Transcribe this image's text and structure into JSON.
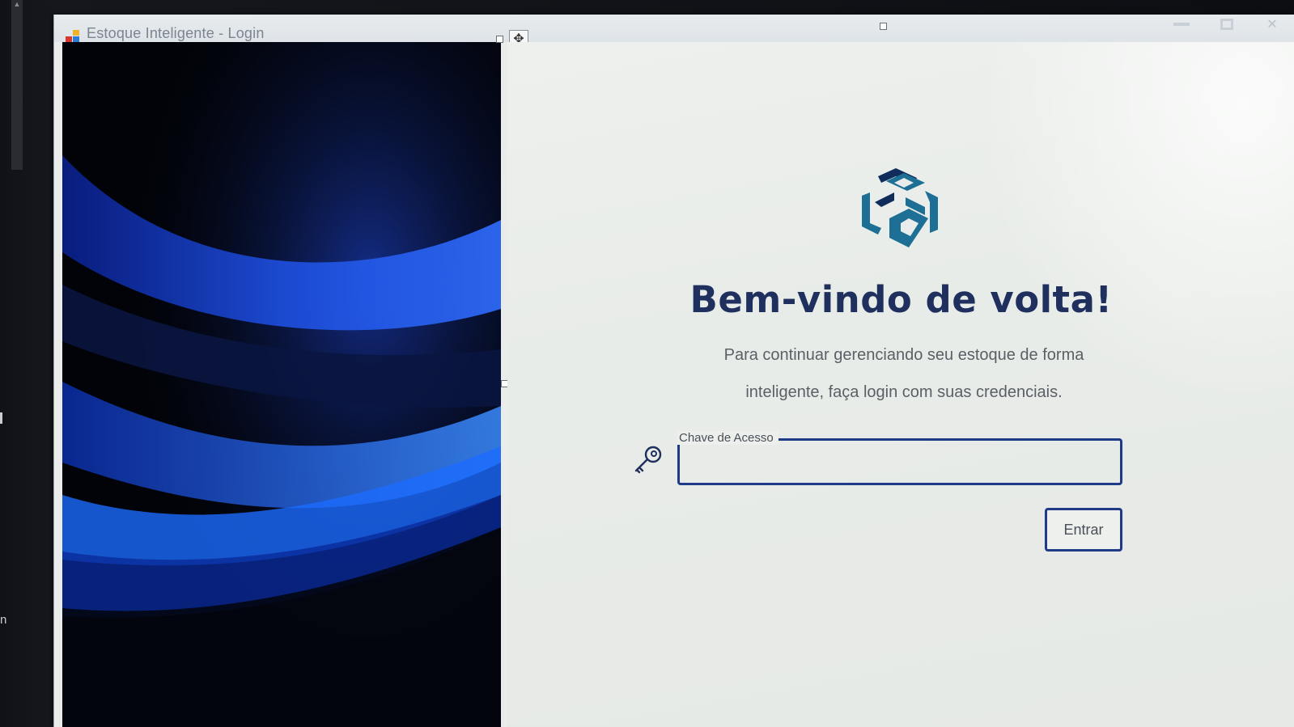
{
  "window": {
    "title": "Estoque Inteligente - Login"
  },
  "login": {
    "heading": "Bem-vindo de volta!",
    "subtitle": "Para continuar gerenciando seu estoque de forma inteligente, faça login com suas credenciais.",
    "field_label": "Chave de Acesso",
    "field_value": "",
    "button_label": "Entrar"
  },
  "desktop": {
    "left_edge_text": "n"
  },
  "icons": {
    "app": "app-logo-icon",
    "key": "key-icon",
    "brand": "brand-cube-logo",
    "move": "move-handle-icon"
  },
  "colors": {
    "heading": "#1f2f5e",
    "accent_border": "#1f3a86",
    "logo_primary": "#1e6f95",
    "logo_dark": "#0f2c5a",
    "background": "#e9ecea"
  }
}
